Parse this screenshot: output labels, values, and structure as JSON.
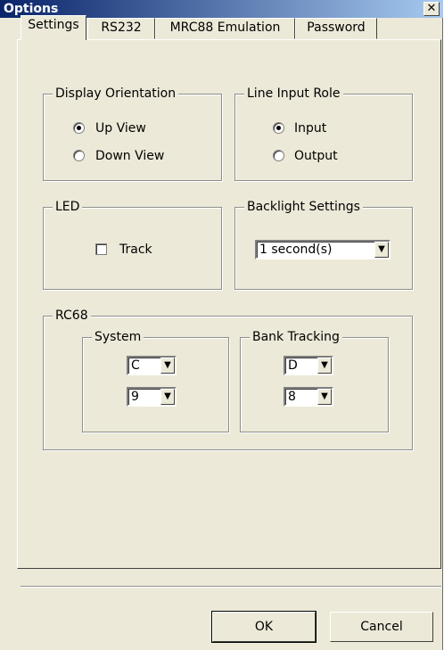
{
  "window": {
    "title": "Options",
    "close_glyph": "✕"
  },
  "tabs": [
    {
      "label": "Settings",
      "active": true
    },
    {
      "label": "RS232",
      "active": false
    },
    {
      "label": "MRC88 Emulation",
      "active": false
    },
    {
      "label": "Password",
      "active": false
    }
  ],
  "display_orientation": {
    "title": "Display Orientation",
    "options": [
      {
        "label": "Up View",
        "selected": true
      },
      {
        "label": "Down View",
        "selected": false
      }
    ]
  },
  "line_input_role": {
    "title": "Line Input Role",
    "options": [
      {
        "label": "Input",
        "selected": true
      },
      {
        "label": "Output",
        "selected": false
      }
    ]
  },
  "led": {
    "title": "LED",
    "track_label": "Track",
    "track_checked": false
  },
  "backlight": {
    "title": "Backlight Settings",
    "value": "1 second(s)"
  },
  "rc68": {
    "title": "RC68",
    "system": {
      "title": "System",
      "letter": "C",
      "number": "9"
    },
    "bank_tracking": {
      "title": "Bank Tracking",
      "letter": "D",
      "number": "8"
    }
  },
  "buttons": {
    "ok": "OK",
    "cancel": "Cancel"
  },
  "icons": {
    "dropdown": "▼"
  }
}
